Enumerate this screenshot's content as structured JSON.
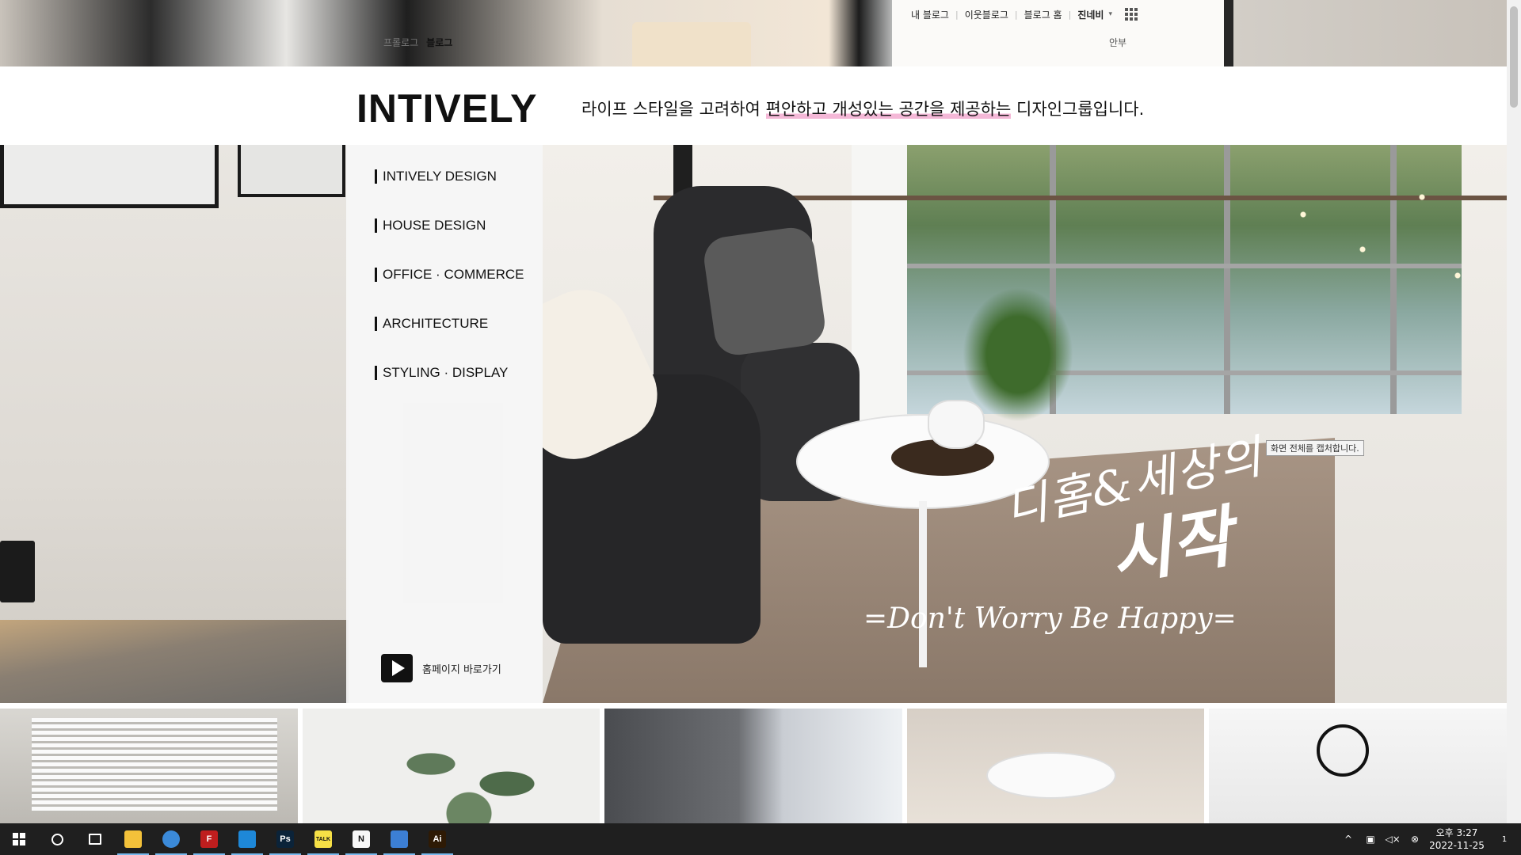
{
  "top_nav": {
    "links": [
      "내 블로그",
      "이웃블로그",
      "블로그 홈"
    ],
    "user": "진네비",
    "apps_icon": "apps-grid-icon"
  },
  "blog_tabs": {
    "profile": "프롤로그",
    "blog": "블로그"
  },
  "side_link": "안부",
  "header": {
    "logo": "INTIVELY",
    "tagline_pre": "라이프 스타일을 고려하여 ",
    "tagline_highlight": "편안하고 개성있는 공간을 제공하는",
    "tagline_post": " 디자인그룹입니다."
  },
  "menu": {
    "items": [
      "INTIVELY DESIGN",
      "HOUSE DESIGN",
      "OFFICE · COMMERCE",
      "ARCHITECTURE",
      "STYLING · DISPLAY"
    ],
    "home_link": "홈페이지 바로가기"
  },
  "hero": {
    "script_line1": "디홈&세상의",
    "script_line2": "시작",
    "slogan": "=Don't Worry Be Happy="
  },
  "tooltip": "화면 전체를 캡처합니다.",
  "taskbar": {
    "apps": [
      {
        "name": "file-explorer",
        "icon": "folder-icon",
        "label": "",
        "color": "#f3c13a"
      },
      {
        "name": "chrome",
        "icon": "chrome-icon",
        "label": "",
        "color": "#3b8ad9"
      },
      {
        "name": "filezilla",
        "icon": "filezilla-icon",
        "label": "F",
        "color": "#bf1e1e"
      },
      {
        "name": "vscode",
        "icon": "vscode-icon",
        "label": "",
        "color": "#1e88d8"
      },
      {
        "name": "photoshop",
        "icon": "photoshop-icon",
        "label": "Ps",
        "color": "#0b2339"
      },
      {
        "name": "kakaotalk",
        "icon": "kakaotalk-icon",
        "label": "TALK",
        "color": "#f6e046"
      },
      {
        "name": "notion",
        "icon": "notion-icon",
        "label": "N",
        "color": "#f7f7f7"
      },
      {
        "name": "bandizip",
        "icon": "bandizip-icon",
        "label": "",
        "color": "#3c7fd4"
      },
      {
        "name": "illustrator",
        "icon": "illustrator-icon",
        "label": "Ai",
        "color": "#2e1a05"
      }
    ],
    "clock_ampm_time": "오후 3:27",
    "clock_date": "2022-11-25",
    "notification_count": "1"
  }
}
